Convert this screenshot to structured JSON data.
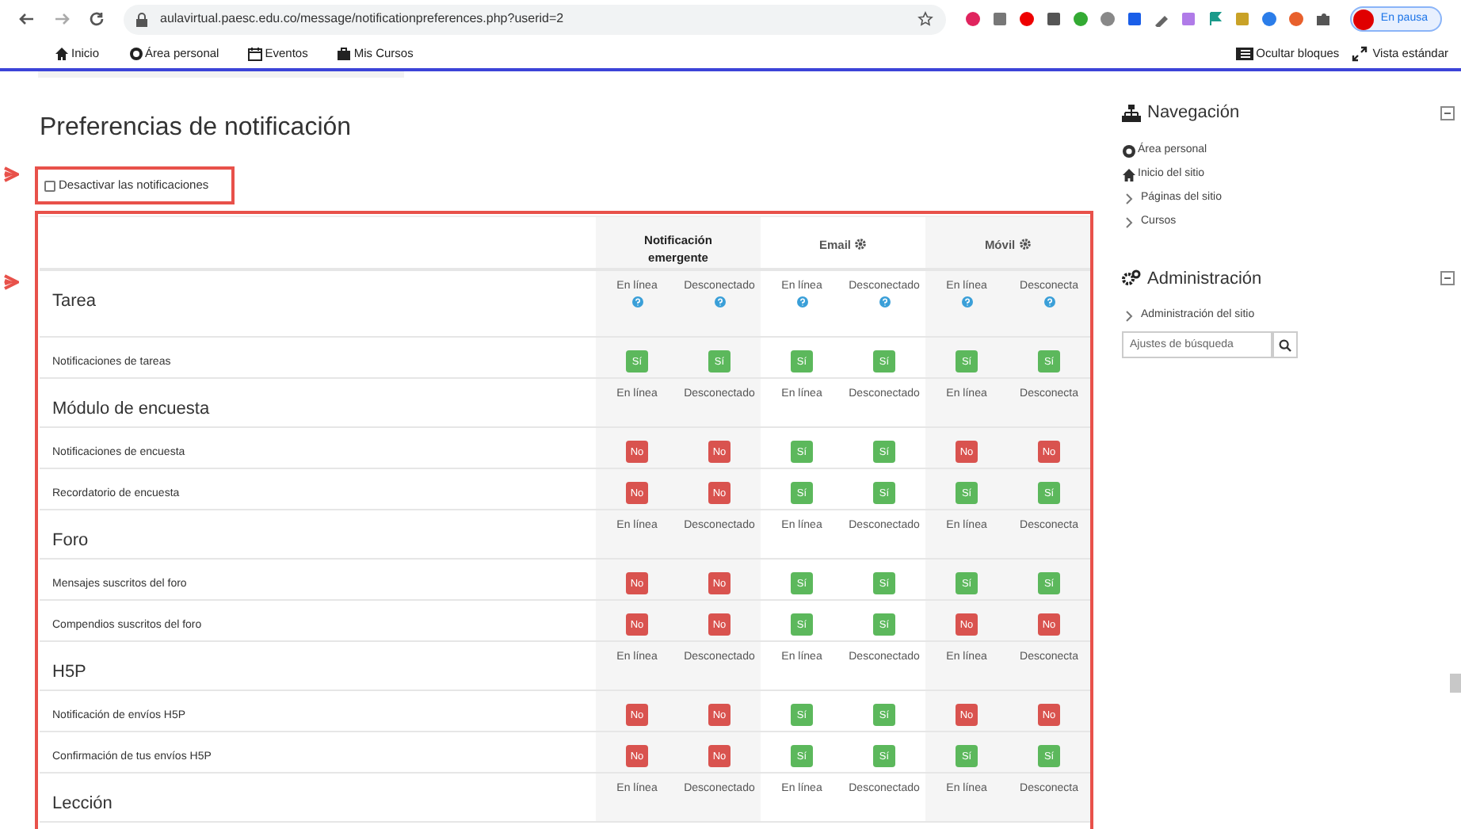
{
  "browser": {
    "url": "aulavirtual.paesc.edu.co/message/notificationpreferences.php?userid=2",
    "profile_label": "En pausa"
  },
  "nav": {
    "links": [
      "Inicio",
      "Área personal",
      "Eventos",
      "Mis Cursos"
    ],
    "actions": [
      "Ocultar bloques",
      "Vista estándar"
    ]
  },
  "title": "Preferencias de notificación",
  "disable_all": {
    "label": "Desactivar las notificaciones",
    "checked": false
  },
  "table": {
    "groups": [
      {
        "label": "Notificación emergente",
        "settings": false
      },
      {
        "label": "Email",
        "settings": true
      },
      {
        "label": "Móvil",
        "settings": true
      }
    ],
    "sections": [
      {
        "title": "Tarea",
        "help": true,
        "states": [
          "En línea",
          "Desconectado",
          "En línea",
          "Desconectado",
          "En línea",
          "Desconecta"
        ],
        "rows": [
          {
            "label": "Notificaciones de tareas",
            "cells": [
              {
                "label": "Sí",
                "enabled": true
              },
              {
                "label": "Sí",
                "enabled": true
              },
              {
                "label": "Sí",
                "enabled": true
              },
              {
                "label": "Sí",
                "enabled": true
              },
              {
                "label": "Sí",
                "enabled": true
              },
              {
                "label": "Sí",
                "enabled": true
              }
            ]
          }
        ]
      },
      {
        "title": "Módulo de encuesta",
        "help": false,
        "states": [
          "En línea",
          "Desconectado",
          "En línea",
          "Desconectado",
          "En línea",
          "Desconecta"
        ],
        "rows": [
          {
            "label": "Notificaciones de encuesta",
            "cells": [
              {
                "label": "No",
                "enabled": false
              },
              {
                "label": "No",
                "enabled": false
              },
              {
                "label": "Sí",
                "enabled": true
              },
              {
                "label": "Sí",
                "enabled": true
              },
              {
                "label": "No",
                "enabled": false
              },
              {
                "label": "No",
                "enabled": false
              }
            ]
          },
          {
            "label": "Recordatorio de encuesta",
            "cells": [
              {
                "label": "No",
                "enabled": false
              },
              {
                "label": "No",
                "enabled": false
              },
              {
                "label": "Sí",
                "enabled": true
              },
              {
                "label": "Sí",
                "enabled": true
              },
              {
                "label": "Sí",
                "enabled": true
              },
              {
                "label": "Sí",
                "enabled": true
              }
            ]
          }
        ]
      },
      {
        "title": "Foro",
        "help": false,
        "states": [
          "En línea",
          "Desconectado",
          "En línea",
          "Desconectado",
          "En línea",
          "Desconecta"
        ],
        "rows": [
          {
            "label": "Mensajes suscritos del foro",
            "cells": [
              {
                "label": "No",
                "enabled": false
              },
              {
                "label": "No",
                "enabled": false
              },
              {
                "label": "Sí",
                "enabled": true
              },
              {
                "label": "Sí",
                "enabled": true
              },
              {
                "label": "Sí",
                "enabled": true
              },
              {
                "label": "Sí",
                "enabled": true
              }
            ]
          },
          {
            "label": "Compendios suscritos del foro",
            "cells": [
              {
                "label": "No",
                "enabled": false
              },
              {
                "label": "No",
                "enabled": false
              },
              {
                "label": "Sí",
                "enabled": true
              },
              {
                "label": "Sí",
                "enabled": true
              },
              {
                "label": "No",
                "enabled": false
              },
              {
                "label": "No",
                "enabled": false
              }
            ]
          }
        ]
      },
      {
        "title": "H5P",
        "help": false,
        "states": [
          "En línea",
          "Desconectado",
          "En línea",
          "Desconectado",
          "En línea",
          "Desconecta"
        ],
        "rows": [
          {
            "label": "Notificación de envíos H5P",
            "cells": [
              {
                "label": "No",
                "enabled": false
              },
              {
                "label": "No",
                "enabled": false
              },
              {
                "label": "Sí",
                "enabled": true
              },
              {
                "label": "Sí",
                "enabled": true
              },
              {
                "label": "No",
                "enabled": false
              },
              {
                "label": "No",
                "enabled": false
              }
            ]
          },
          {
            "label": "Confirmación de tus envíos H5P",
            "cells": [
              {
                "label": "No",
                "enabled": false
              },
              {
                "label": "No",
                "enabled": false
              },
              {
                "label": "Sí",
                "enabled": true
              },
              {
                "label": "Sí",
                "enabled": true
              },
              {
                "label": "Sí",
                "enabled": true
              },
              {
                "label": "Sí",
                "enabled": true
              }
            ]
          }
        ]
      },
      {
        "title": "Lección",
        "help": false,
        "states": [
          "En línea",
          "Desconectado",
          "En línea",
          "Desconectado",
          "En línea",
          "Desconecta"
        ]
      }
    ]
  },
  "sidebar": {
    "blocks": [
      {
        "title": "Navegación",
        "kind": "navigation",
        "items": [
          {
            "label": "Área personal",
            "kind": "dashboard"
          },
          {
            "label": "Inicio del sitio",
            "kind": "home"
          },
          {
            "label": "Páginas del sitio",
            "kind": "branch"
          },
          {
            "label": "Cursos",
            "kind": "branch"
          }
        ]
      },
      {
        "title": "Administración",
        "kind": "administration",
        "items": [
          {
            "label": "Administración del sitio",
            "kind": "branch"
          }
        ],
        "search": {
          "placeholder": "Ajustes de búsqueda"
        }
      }
    ]
  }
}
